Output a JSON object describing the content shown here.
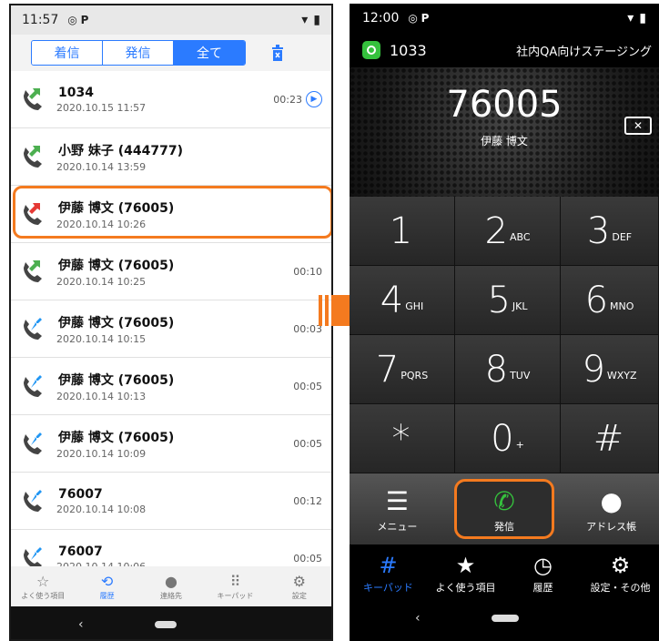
{
  "left": {
    "status": {
      "time": "11:57"
    },
    "filters": [
      "着信",
      "発信",
      "全て"
    ],
    "calls": [
      {
        "name": "1034",
        "date": "2020.10.15 11:57",
        "duration": "00:23",
        "type": "out"
      },
      {
        "name": "小野 妹子 (444777)",
        "date": "2020.10.14 13:59",
        "duration": "",
        "type": "out"
      },
      {
        "name": "伊藤 博文 (76005)",
        "date": "2020.10.14 10:26",
        "duration": "",
        "type": "missed"
      },
      {
        "name": "伊藤 博文 (76005)",
        "date": "2020.10.14 10:25",
        "duration": "00:10",
        "type": "out"
      },
      {
        "name": "伊藤 博文 (76005)",
        "date": "2020.10.14 10:15",
        "duration": "00:03",
        "type": "in"
      },
      {
        "name": "伊藤 博文 (76005)",
        "date": "2020.10.14 10:13",
        "duration": "00:05",
        "type": "in"
      },
      {
        "name": "伊藤 博文 (76005)",
        "date": "2020.10.14 10:09",
        "duration": "00:05",
        "type": "in"
      },
      {
        "name": "76007",
        "date": "2020.10.14 10:08",
        "duration": "00:12",
        "type": "in"
      },
      {
        "name": "76007",
        "date": "2020.10.14 10:06",
        "duration": "00:05",
        "type": "in"
      }
    ],
    "nav": [
      "よく使う項目",
      "履歴",
      "連絡先",
      "キーパッド",
      "設定"
    ]
  },
  "right": {
    "status": {
      "time": "12:00"
    },
    "account": "1033",
    "environment": "社内QA向けステージング",
    "dialed_number": "76005",
    "dialed_name": "伊藤 博文",
    "keys": [
      {
        "d": "1",
        "l": ""
      },
      {
        "d": "2",
        "l": "ABC"
      },
      {
        "d": "3",
        "l": "DEF"
      },
      {
        "d": "4",
        "l": "GHI"
      },
      {
        "d": "5",
        "l": "JKL"
      },
      {
        "d": "6",
        "l": "MNO"
      },
      {
        "d": "7",
        "l": "PQRS"
      },
      {
        "d": "8",
        "l": "TUV"
      },
      {
        "d": "9",
        "l": "WXYZ"
      },
      {
        "d": "*",
        "l": ""
      },
      {
        "d": "0",
        "l": "+"
      },
      {
        "d": "#",
        "l": ""
      }
    ],
    "actions": {
      "menu": "メニュー",
      "call": "発信",
      "address": "アドレス帳"
    },
    "nav": [
      "キーパッド",
      "よく使う項目",
      "履歴",
      "設定・その他"
    ]
  },
  "colors": {
    "accent": "#2b7bff",
    "highlight": "#f47a1f",
    "call_green": "#35c13d"
  }
}
